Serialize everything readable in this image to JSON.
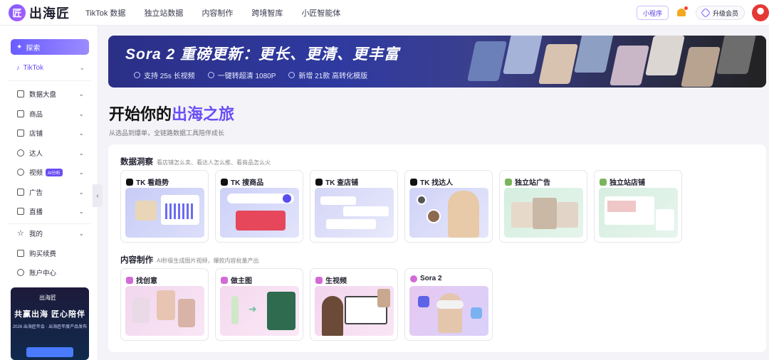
{
  "app": {
    "logo_mark": "匠",
    "logo_text": "出海匠"
  },
  "nav": [
    "TikTok 数据",
    "独立站数据",
    "内容制作",
    "跨境智库",
    "小匠智能体"
  ],
  "topright": {
    "mini_program": "小程序",
    "upgrade": "升级会员"
  },
  "sidebar": {
    "explore": "探索",
    "platform": "TikTok",
    "items": [
      {
        "label": "数据大盘"
      },
      {
        "label": "商品"
      },
      {
        "label": "店铺"
      },
      {
        "label": "达人"
      },
      {
        "label": "视频",
        "tag": "AI分析"
      },
      {
        "label": "广告"
      },
      {
        "label": "直播"
      },
      {
        "label": "我的"
      },
      {
        "label": "购买续费"
      },
      {
        "label": "账户中心"
      }
    ],
    "promo": {
      "logo": "出海匠",
      "title": "共赢出海 匠心陪伴",
      "sub": "2026 出海匠年会 · 出海匠年度产品发布"
    }
  },
  "banner": {
    "title": "Sora 2 重磅更新：更长、更清、更丰富",
    "features": [
      "支持 25s 长视频",
      "一键转超清 1080P",
      "新增 21款 高转化模版"
    ]
  },
  "journey": {
    "title_pre": "开始你的",
    "title_hl": "出海之旅",
    "subtitle": "从选品到爆单，全链路数据工具陪伴成长"
  },
  "sections": [
    {
      "title": "数据洞察",
      "desc": "看店铺怎么卖、看达人怎么推、看商品怎么火",
      "cards": [
        {
          "title": "TK 看趋势",
          "icon": "tiktok-icon"
        },
        {
          "title": "TK 搜商品",
          "icon": "tiktok-icon"
        },
        {
          "title": "TK 查店铺",
          "icon": "tiktok-icon"
        },
        {
          "title": "TK 找达人",
          "icon": "tiktok-icon"
        },
        {
          "title": "独立站广告",
          "icon": "shopify-icon"
        },
        {
          "title": "独立站店铺",
          "icon": "shopify-icon"
        }
      ]
    },
    {
      "title": "内容制作",
      "desc": "AI秒级生成图片视频，爆款内容批量产出",
      "cards": [
        {
          "title": "找创意",
          "icon": "idea-icon"
        },
        {
          "title": "做主图",
          "icon": "image-icon"
        },
        {
          "title": "生视频",
          "icon": "video-icon"
        },
        {
          "title": "Sora 2",
          "icon": "sora-icon"
        }
      ]
    }
  ],
  "colors": {
    "accent": "#6a4df3",
    "banner": "#2b2f86",
    "bell": "#f2a91f"
  }
}
